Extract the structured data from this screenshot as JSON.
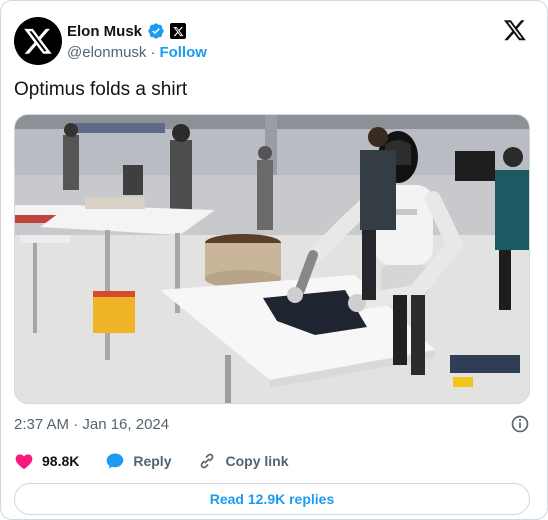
{
  "author": {
    "name": "Elon Musk",
    "handle": "@elonmusk",
    "separator": "·",
    "follow_label": "Follow"
  },
  "tweet": {
    "text": "Optimus folds a shirt",
    "timestamp": "2:37 AM · Jan 16, 2024"
  },
  "actions": {
    "likes": "98.8K",
    "reply_label": "Reply",
    "copy_link_label": "Copy link"
  },
  "replies_button": "Read 12.9K replies",
  "icons": {
    "avatar": "x-logo-avatar-icon",
    "verified": "verified-badge-icon",
    "affiliate": "x-affiliate-badge-icon",
    "brand": "x-logo-icon",
    "info": "info-icon",
    "like": "heart-icon",
    "reply": "reply-bubble-icon",
    "copy": "link-icon"
  },
  "colors": {
    "accent": "#1d9bf0",
    "like": "#f91880",
    "muted": "#536471",
    "text": "#0f1419"
  }
}
